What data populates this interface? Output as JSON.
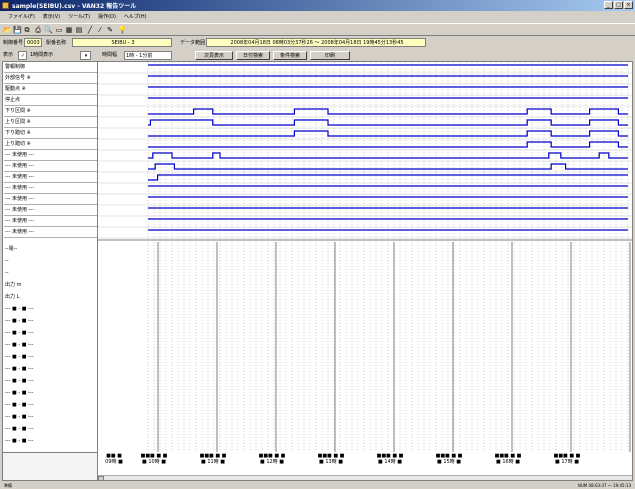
{
  "window": {
    "title": "sample(SEIBU).csv - VAN32 報告ツール",
    "minimize_glyph": "_",
    "maximize_glyph": "□",
    "close_glyph": "×"
  },
  "menu": {
    "items": [
      "ファイル(F)",
      "表示(V)",
      "ツール(T)",
      "操作(O)",
      "ヘルプ(H)"
    ]
  },
  "toolbar": {
    "icons": [
      "open-icon",
      "save-icon",
      "copy-icon",
      "print-icon",
      "preview-icon",
      "window-icon",
      "grid-icon",
      "table-icon",
      "line-icon",
      "slash-icon",
      "pencil-icon",
      "bulb-icon"
    ]
  },
  "info": {
    "station_code_label": "制御番号",
    "station_code": "0003",
    "station_name_label": "駅番名称",
    "station_name": "SEIBU - 3",
    "data_period_label": "データ範囲",
    "data_period": "2008年04月18日 08時03分37秒26 ～ 2008年04月18日 19時45分13秒45"
  },
  "controls": {
    "display_label": "表示",
    "display_checked": "✓",
    "mode_label": "1時間表示",
    "range_label": "時間幅",
    "range_value": "1時 - 1分前",
    "btn_next": "次頁表示",
    "btn_search": "日付検索",
    "btn_condition": "条件検索",
    "btn_print": "印刷"
  },
  "signals": [
    "警報制御",
    "外部信号 ※",
    "駆動点 ※",
    "停止点",
    "下り区間 ※",
    "上り区間 ※",
    "下り踏切 ※",
    "上り踏切 ※",
    "--- 未使用 ---",
    "--- 未使用 ---",
    "--- 未使用 ---",
    "--- 未使用 ---",
    "--- 未使用 ---",
    "--- 未使用 ---",
    "--- 未使用 ---",
    "--- 未使用 ---"
  ],
  "analog_labels": [
    "--電--",
    "--",
    "--",
    "出力 m",
    "出力 L",
    "--- ■ - ■ ---",
    "--- ■ - ■ ---",
    "--- ■ - ■ ---",
    "--- ■ - ■ ---",
    "--- ■ - ■ ---",
    "--- ■ - ■ ---",
    "--- ■ - ■ ---",
    "--- ■ - ■ ---",
    "--- ■ - ■ ---",
    "--- ■ - ■ ---",
    "--- ■ - ■ ---",
    "--- ■ - ■ ---"
  ],
  "time_axis": [
    {
      "line1": "■■ ■",
      "line2": "09時 ■"
    },
    {
      "line1": "■■■ ■ ■",
      "line2": "■ 10時 ■"
    },
    {
      "line1": "■■■ ■ ■",
      "line2": "■ 11時 ■"
    },
    {
      "line1": "■■■ ■ ■",
      "line2": "■ 12時 ■"
    },
    {
      "line1": "■■■ ■ ■",
      "line2": "■ 13時 ■"
    },
    {
      "line1": "■■■ ■ ■",
      "line2": "■ 14時 ■"
    },
    {
      "line1": "■■■ ■ ■",
      "line2": "■ 15時 ■"
    },
    {
      "line1": "■■■ ■ ■",
      "line2": "■ 16時 ■"
    },
    {
      "line1": "■■■ ■ ■",
      "line2": "■ 17時 ■"
    }
  ],
  "waveforms": {
    "line_color": "#0000cc",
    "time_range": [
      0,
      100
    ],
    "channels": [
      {
        "init": 1,
        "edges": []
      },
      {
        "init": 1,
        "edges": []
      },
      {
        "init": 1,
        "edges": []
      },
      {
        "init": 1,
        "edges": []
      },
      {
        "init": 0,
        "edges": [
          9.5,
          13.5,
          30.5,
          37.5,
          79,
          84,
          92,
          98
        ]
      },
      {
        "init": 0,
        "edges": [
          0.5,
          13.5,
          30.5,
          37.5,
          79,
          84,
          92,
          98
        ]
      },
      {
        "init": 0,
        "edges": [
          30.5,
          37.5,
          79,
          84,
          92,
          98
        ]
      },
      {
        "init": 0,
        "edges": [
          79,
          84,
          92,
          98
        ]
      },
      {
        "init": 0,
        "edges": [
          1,
          5,
          13.5,
          15,
          83.5,
          86,
          94,
          96
        ]
      },
      {
        "init": 0,
        "edges": [
          1.5,
          5.5,
          84,
          87
        ]
      },
      {
        "init": 0,
        "edges": [
          2
        ]
      },
      {
        "init": 1,
        "edges": []
      },
      {
        "init": 1,
        "edges": []
      },
      {
        "init": 1,
        "edges": []
      },
      {
        "init": 1,
        "edges": []
      },
      {
        "init": 1,
        "edges": []
      }
    ]
  },
  "status": {
    "left": "準備",
    "right": "NUM 08:03:37 ～ 19:45:13"
  }
}
